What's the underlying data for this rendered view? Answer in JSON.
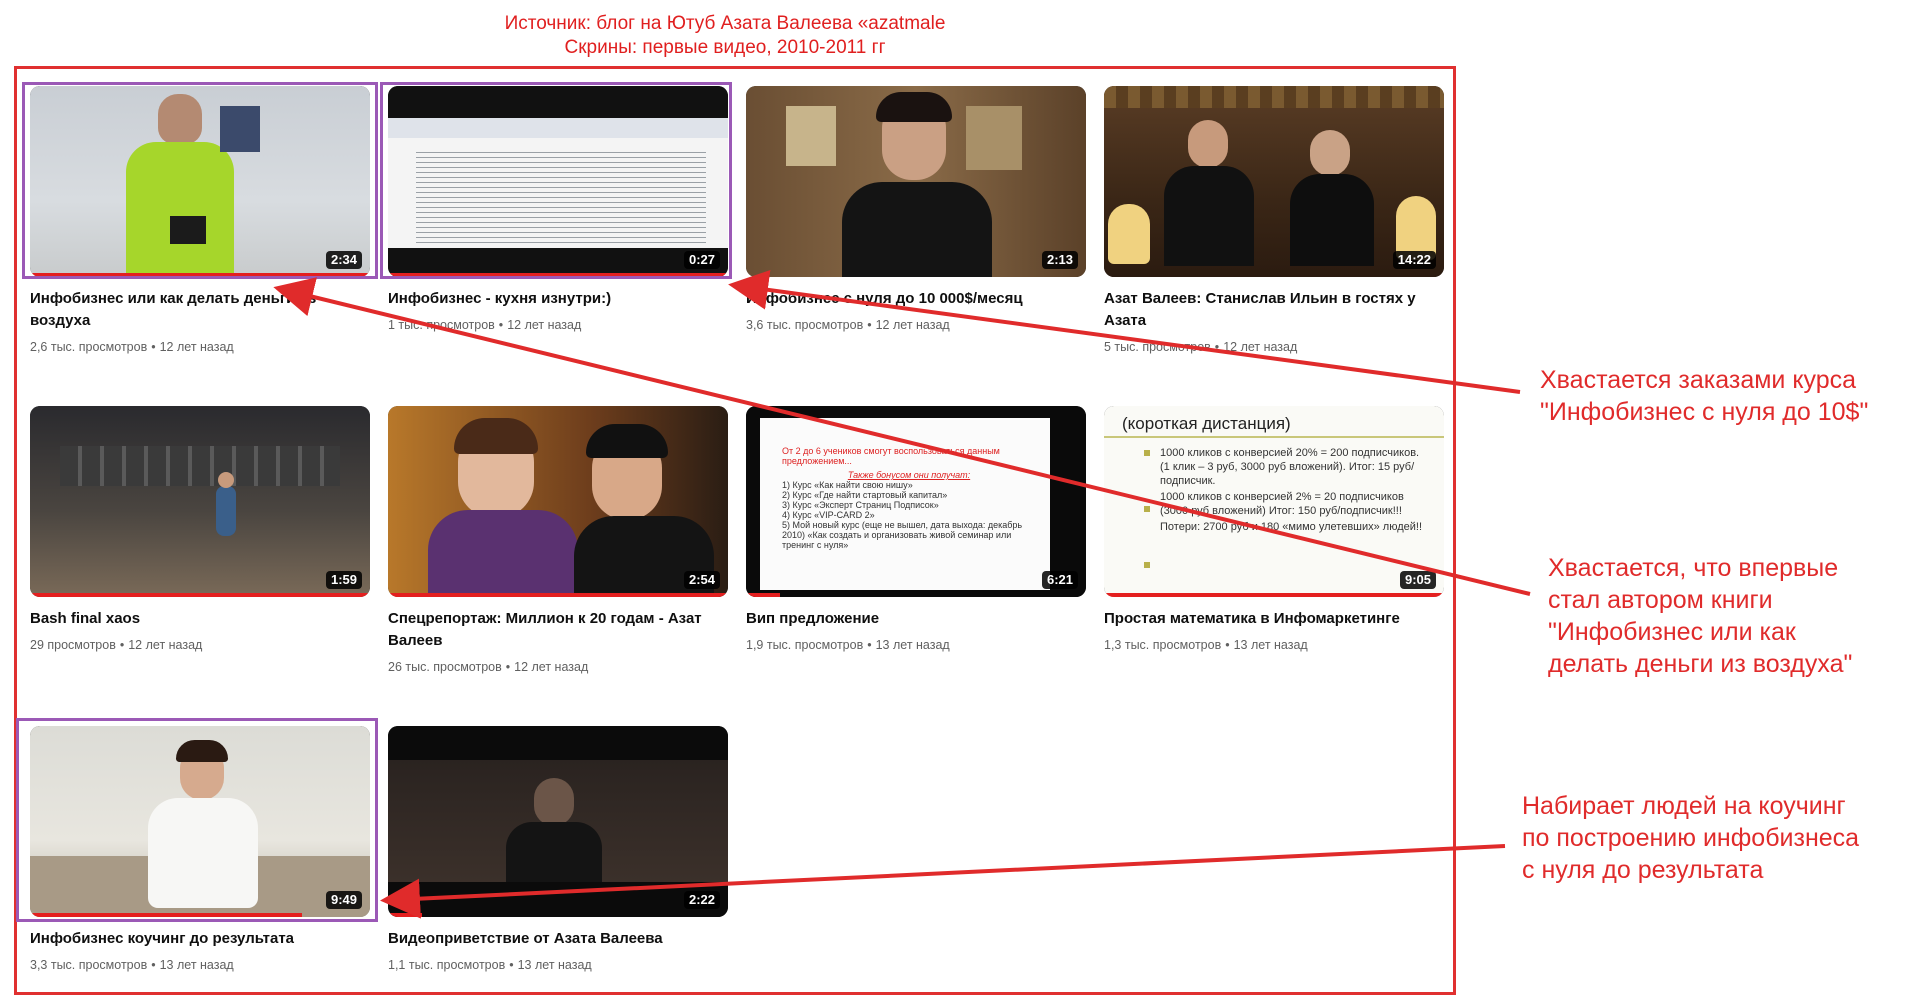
{
  "source_note": {
    "line1": "Источник: блог на Ютуб Азата Валеева «azatmale",
    "line2": "Скрины: первые видео, 2010-2011 гг"
  },
  "videos": [
    {
      "title": "Инфобизнес или как делать деньги из воздуха",
      "views": "2,6 тыс. просмотров",
      "age": "12 лет назад",
      "duration": "2:34",
      "watched": 1.0,
      "highlighted": true
    },
    {
      "title": "Инфобизнес - кухня изнутри:)",
      "views": "1 тыс. просмотров",
      "age": "12 лет назад",
      "duration": "0:27",
      "watched": 1.0,
      "highlighted": true
    },
    {
      "title": "Инфобизнес с нуля до 10 000$/месяц",
      "views": "3,6 тыс. просмотров",
      "age": "12 лет назад",
      "duration": "2:13",
      "watched": 0.0,
      "highlighted": false
    },
    {
      "title": "Азат Валеев: Станислав Ильин в гостях у Азата",
      "views": "5 тыс. просмотров",
      "age": "12 лет назад",
      "duration": "14:22",
      "watched": 0.0,
      "highlighted": false
    },
    {
      "title": "Bash final xaos",
      "views": "29 просмотров",
      "age": "12 лет назад",
      "duration": "1:59",
      "watched": 1.0,
      "highlighted": false
    },
    {
      "title": "Спецрепортаж: Миллион к 20 годам - Азат Валеев",
      "views": "26 тыс. просмотров",
      "age": "12 лет назад",
      "duration": "2:54",
      "watched": 1.0,
      "highlighted": false
    },
    {
      "title": "Вип предложение",
      "views": "1,9 тыс. просмотров",
      "age": "13 лет назад",
      "duration": "6:21",
      "watched": 0.1,
      "highlighted": false
    },
    {
      "title": "Простая математика в Инфомаркетинге",
      "views": "1,3 тыс. просмотров",
      "age": "13 лет назад",
      "duration": "9:05",
      "watched": 1.0,
      "highlighted": false
    },
    {
      "title": "Инфобизнес коучинг до результата",
      "views": "3,3 тыс. просмотров",
      "age": "13 лет назад",
      "duration": "9:49",
      "watched": 0.8,
      "highlighted": true
    },
    {
      "title": "Видеоприветствие от Азата Валеева",
      "views": "1,1 тыс. просмотров",
      "age": "13 лет назад",
      "duration": "2:22",
      "watched": 0.1,
      "highlighted": false
    }
  ],
  "slide_math": {
    "heading": "(короткая дистанция)",
    "bullets": [
      "1000 кликов с конверсией 20% = 200 подписчиков. (1 клик – 3 руб, 3000 руб вложений). Итог: 15 руб/подписчик.",
      "1000 кликов с конверсией 2% = 20 подписчиков (3000 руб вложений) Итог: 150 руб/подписчик!!!",
      "Потери: 2700 руб и 180 «мимо улетевших» людей!!"
    ]
  },
  "slide_vip": {
    "intro": "От 2 до 6 учеников смогут воспользоваться данным предложением...",
    "bonus_heading": "Также бонусом они получат:",
    "items": [
      "1) Курс «Как найти свою нишу»",
      "2) Курс «Где найти стартовый капитал»",
      "3) Курс «Эксперт Страниц Подписок»",
      "4) Курс «VIP-CARD 2»",
      "5) Мой новый курс (еще не вышел, дата выхода: декабрь 2010) «Как создать и организовать живой семинар или тренинг с нуля»"
    ]
  },
  "annotations": {
    "a1": [
      "Хвастается заказами курса",
      "\"Инфобизнес с нуля до 10$\""
    ],
    "a2": [
      "Хвастается, что впервые",
      "стал автором книги",
      "\"Инфобизнес или как",
      "делать деньги из воздуха\""
    ],
    "a3": [
      "Набирает людей на коучинг",
      "по построению инфобизнеса",
      "с нуля до результата"
    ]
  },
  "colors": {
    "annotation": "#e02b2b",
    "highlight": "#9b59b6",
    "frame": "#e03030",
    "progress": "#e41f1f"
  }
}
